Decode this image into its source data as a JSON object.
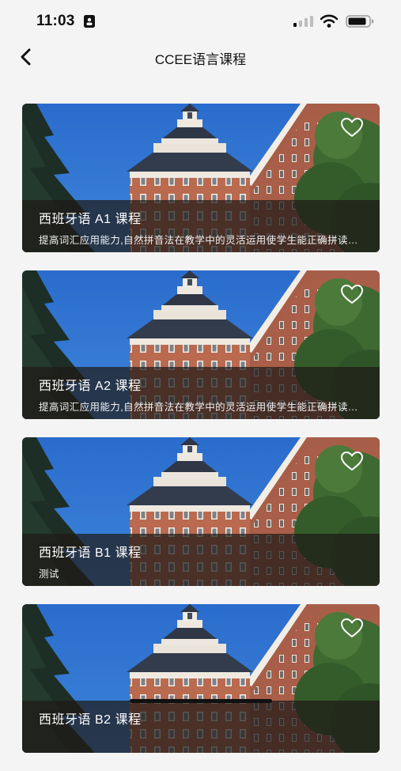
{
  "status_bar": {
    "time": "11:03"
  },
  "nav": {
    "title": "CCEE语言课程",
    "back_icon": "chevron-left-icon"
  },
  "courses": [
    {
      "title": "西班牙语 A1 课程",
      "description": "提高词汇应用能力,自然拼音法在教学中的灵活运用使学生能正确拼读单词",
      "favorite_icon": "heart-outline-icon"
    },
    {
      "title": "西班牙语 A2 课程",
      "description": "提高词汇应用能力,自然拼音法在教学中的灵活运用使学生能正确拼读单词",
      "favorite_icon": "heart-outline-icon"
    },
    {
      "title": "西班牙语 B1 课程",
      "description": "测试",
      "favorite_icon": "heart-outline-icon"
    },
    {
      "title": "西班牙语 B2 课程",
      "description": "",
      "favorite_icon": "heart-outline-icon"
    }
  ]
}
